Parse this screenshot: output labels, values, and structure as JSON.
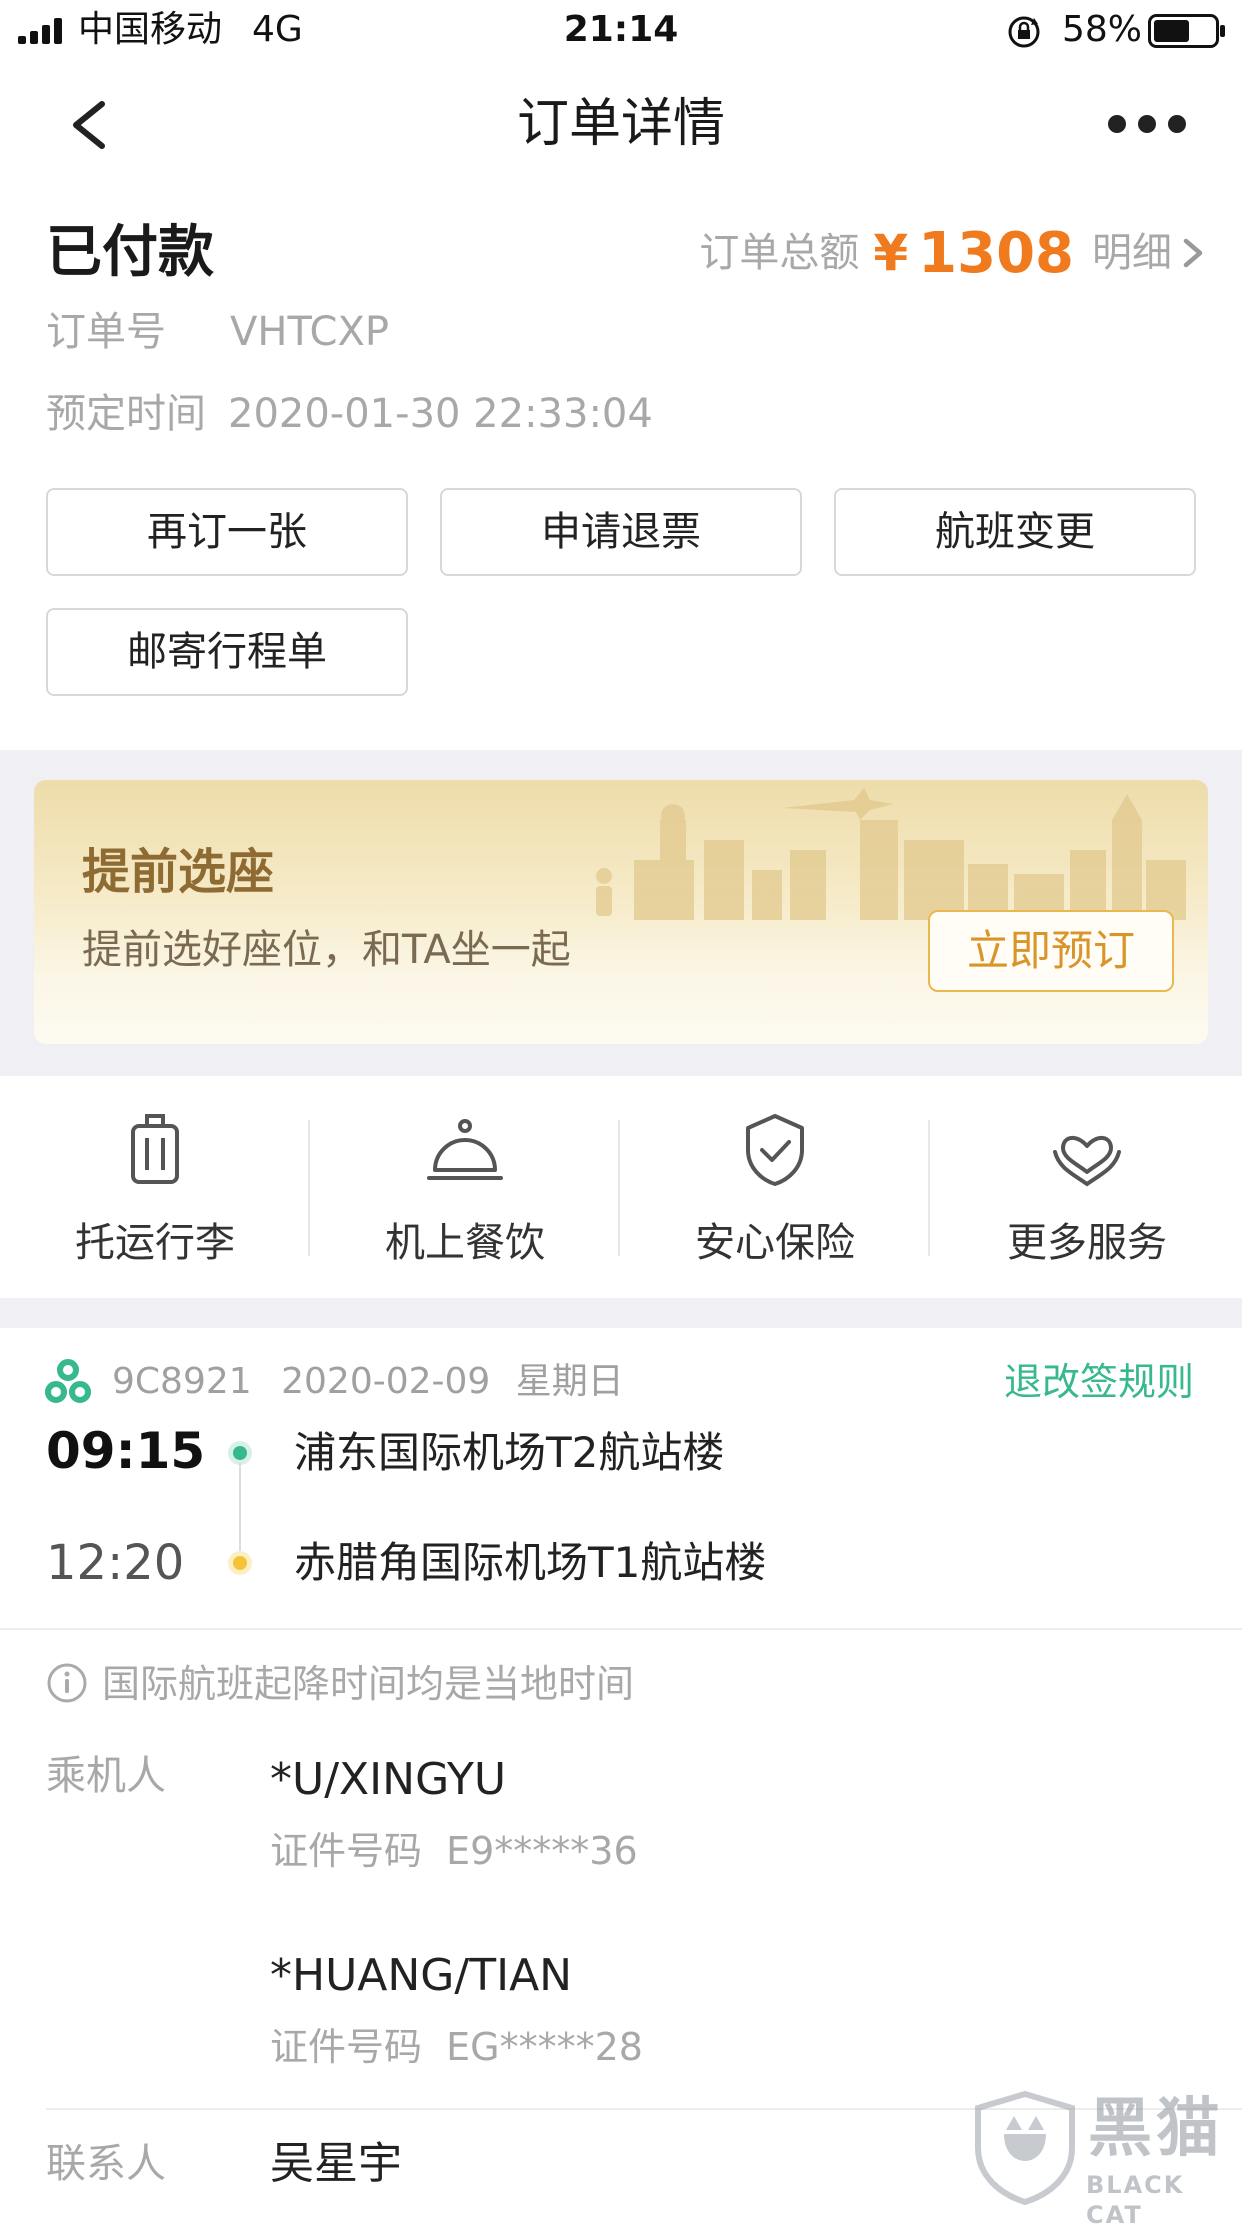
{
  "status_bar": {
    "carrier": "中国移动",
    "network": "4G",
    "time": "21:14",
    "battery": "58%",
    "battery_level": 0.58
  },
  "nav": {
    "title": "订单详情"
  },
  "order": {
    "status": "已付款",
    "total_label": "订单总额",
    "currency": "¥",
    "total_amount": "1308",
    "detail_link": "明细",
    "number_label": "订单号",
    "number_value": "VHTCXP",
    "booking_time_label": "预定时间",
    "booking_time_value": "2020-01-30 22:33:04"
  },
  "actions": [
    "再订一张",
    "申请退票",
    "航班变更",
    "邮寄行程单"
  ],
  "promo": {
    "title": "提前选座",
    "subtitle": "提前选好座位，和TA坐一起",
    "button": "立即预订"
  },
  "services": [
    {
      "label": "托运行李",
      "icon": "luggage-icon"
    },
    {
      "label": "机上餐饮",
      "icon": "food-cloche-icon"
    },
    {
      "label": "安心保险",
      "icon": "shield-check-icon"
    },
    {
      "label": "更多服务",
      "icon": "heart-hand-icon"
    }
  ],
  "flight": {
    "flight_no": "9C8921",
    "date": "2020-02-09",
    "weekday": "星期日",
    "rules_link": "退改签规则",
    "departure_time": "09:15",
    "departure_airport": "浦东国际机场T2航站楼",
    "arrival_time": "12:20",
    "arrival_airport": "赤腊角国际机场T1航站楼"
  },
  "notice": "国际航班起降时间均是当地时间",
  "passengers": {
    "label": "乘机人",
    "list": [
      {
        "name": "*U/XINGYU",
        "id_label": "证件号码",
        "id_value": "E9*****36"
      },
      {
        "name": "*HUANG/TIAN",
        "id_label": "证件号码",
        "id_value": "EG*****28"
      }
    ]
  },
  "contact": {
    "label": "联系人",
    "name": "吴星宇"
  },
  "watermark": {
    "text_cn": "黑猫",
    "text_en": "BLACK CAT"
  },
  "colors": {
    "price": "#f07a1e",
    "accent_green": "#37b88d",
    "promo_text": "#8e6b32",
    "promo_button": "#d9952a"
  }
}
